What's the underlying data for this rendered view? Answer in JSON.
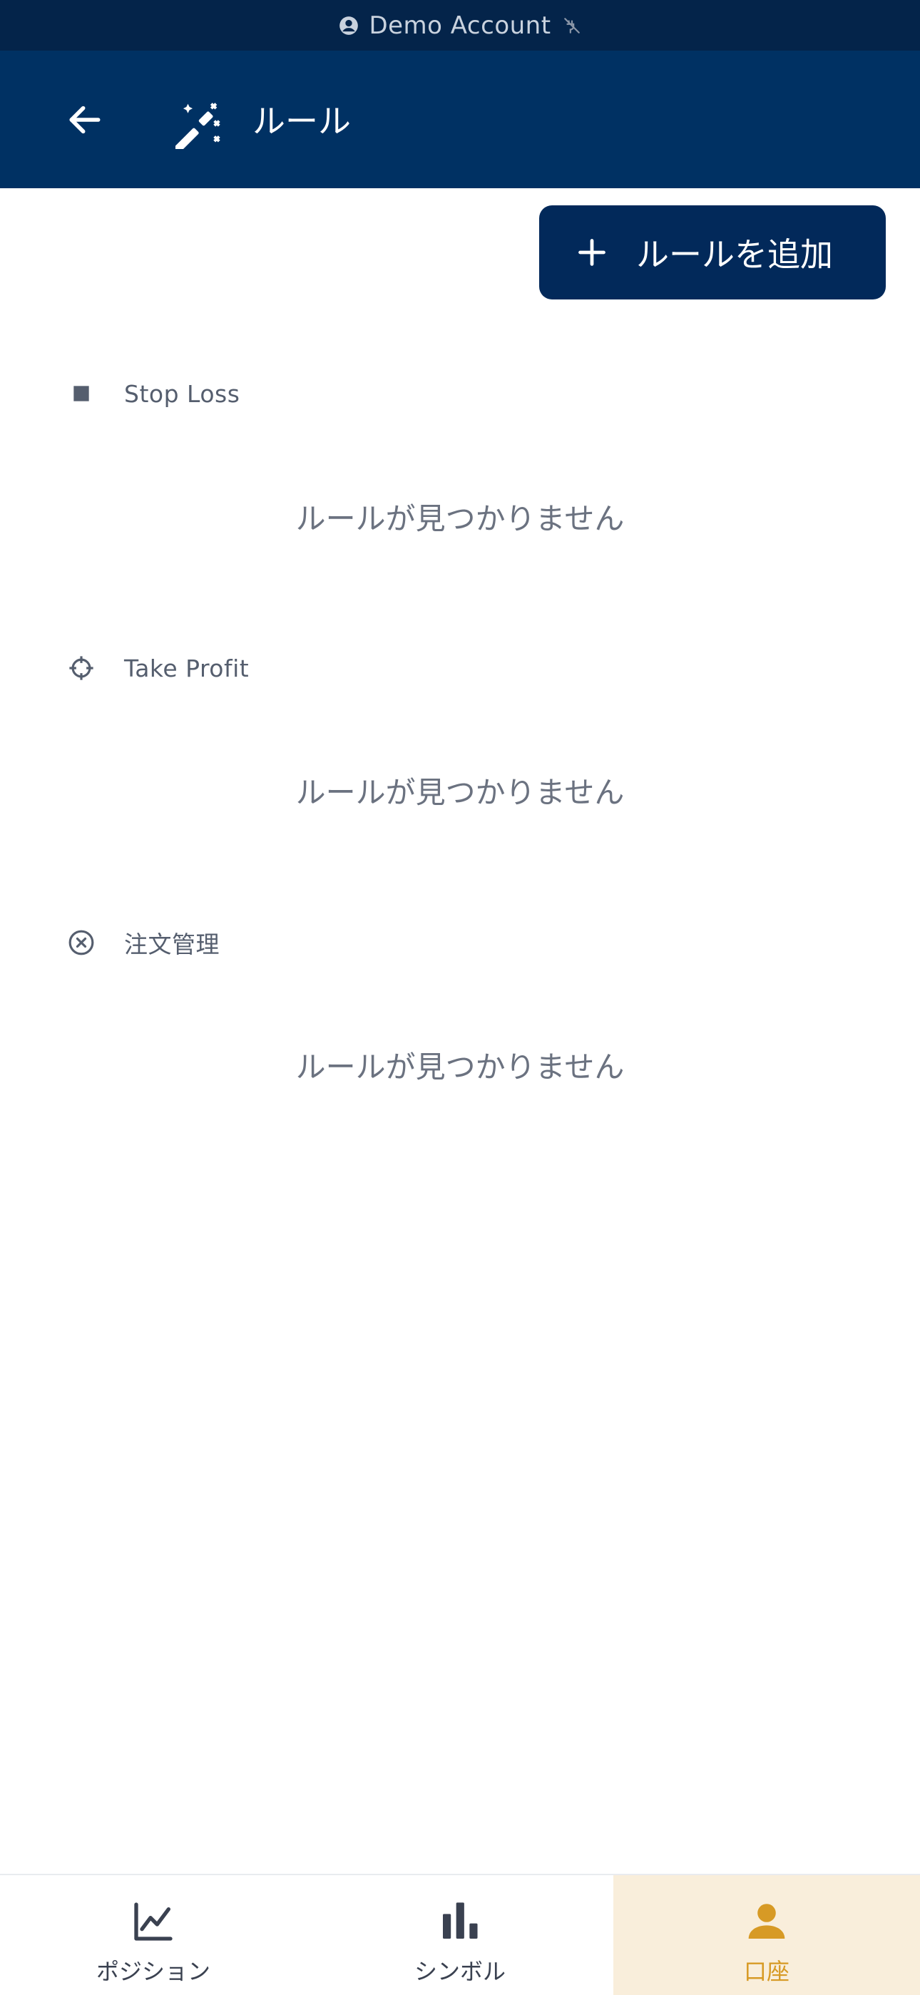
{
  "status_bar": {
    "account_label": "Demo Account",
    "account_icon": "account-circle-icon",
    "connection_icon": "unplugged-icon"
  },
  "header": {
    "title": "ルール",
    "back_icon": "arrow-left-icon",
    "title_icon": "magic-wand-icon"
  },
  "toolbar": {
    "add_rule_label": "ルールを追加",
    "add_icon": "plus-icon"
  },
  "sections": [
    {
      "title": "Stop Loss",
      "icon": "square-icon",
      "empty_text": "ルールが見つかりません"
    },
    {
      "title": "Take Profit",
      "icon": "crosshair-icon",
      "empty_text": "ルールが見つかりません"
    },
    {
      "title": "注文管理",
      "icon": "circle-x-icon",
      "empty_text": "ルールが見つかりません"
    }
  ],
  "bottom_nav": {
    "items": [
      {
        "label": "ポジション",
        "icon": "line-chart-icon",
        "active": false
      },
      {
        "label": "シンボル",
        "icon": "bar-chart-icon",
        "active": false
      },
      {
        "label": "口座",
        "icon": "person-icon",
        "active": true
      }
    ]
  },
  "colors": {
    "status_bar_bg": "#04244a",
    "header_bg": "#003163",
    "button_bg": "#02295a",
    "active_tab_bg": "#f9eedb",
    "active_tab_fg": "#d79a25"
  }
}
